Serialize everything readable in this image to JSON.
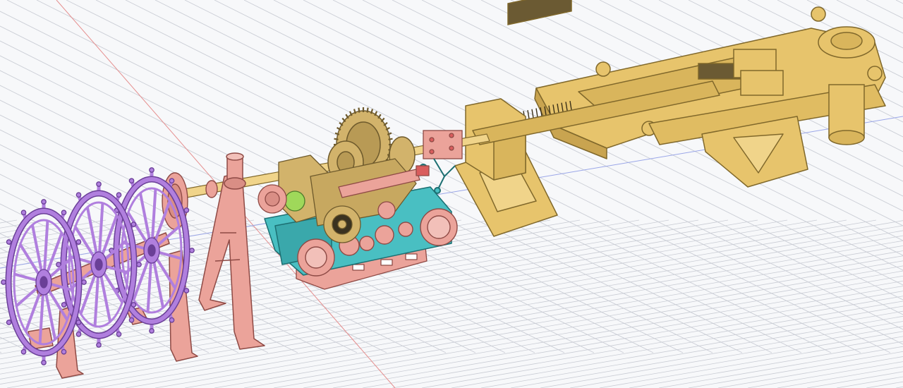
{
  "viewport": {
    "background": "#f7f8fa",
    "grid_color": "#c9ccd4",
    "axis_x_color": "#e58f8f",
    "axis_y_color": "#9aa6e8"
  },
  "palette": {
    "wheel_purple": "#b07fde",
    "wheel_purple_dark": "#6a3f97",
    "frame_pink": "#eba39a",
    "frame_pink_dark": "#8e4a45",
    "machine_teal": "#49bfc2",
    "machine_teal_dark": "#1c6f72",
    "gear_tan": "#d2b36b",
    "gear_tan_dark": "#6e5a2c",
    "frame_yellow": "#e7c46c",
    "frame_yellow_dark": "#80682b",
    "accent_green": "#9fd85a",
    "accent_red": "#d95d5d"
  },
  "model": {
    "parts": [
      "steering-wheel-front",
      "steering-wheel-middle",
      "steering-wheel-rear",
      "wheel-support-frame",
      "drive-shaft",
      "pinion-gear",
      "a-frame-pedestal",
      "gearbox-machinery",
      "bevel-gear-large",
      "teal-base-housing",
      "pink-base-plate",
      "shaft-coupling",
      "governor-linkage",
      "yellow-support-stand",
      "screw-shaft-housing",
      "tiller-arm-frame",
      "rudder-post-cylinder"
    ]
  }
}
